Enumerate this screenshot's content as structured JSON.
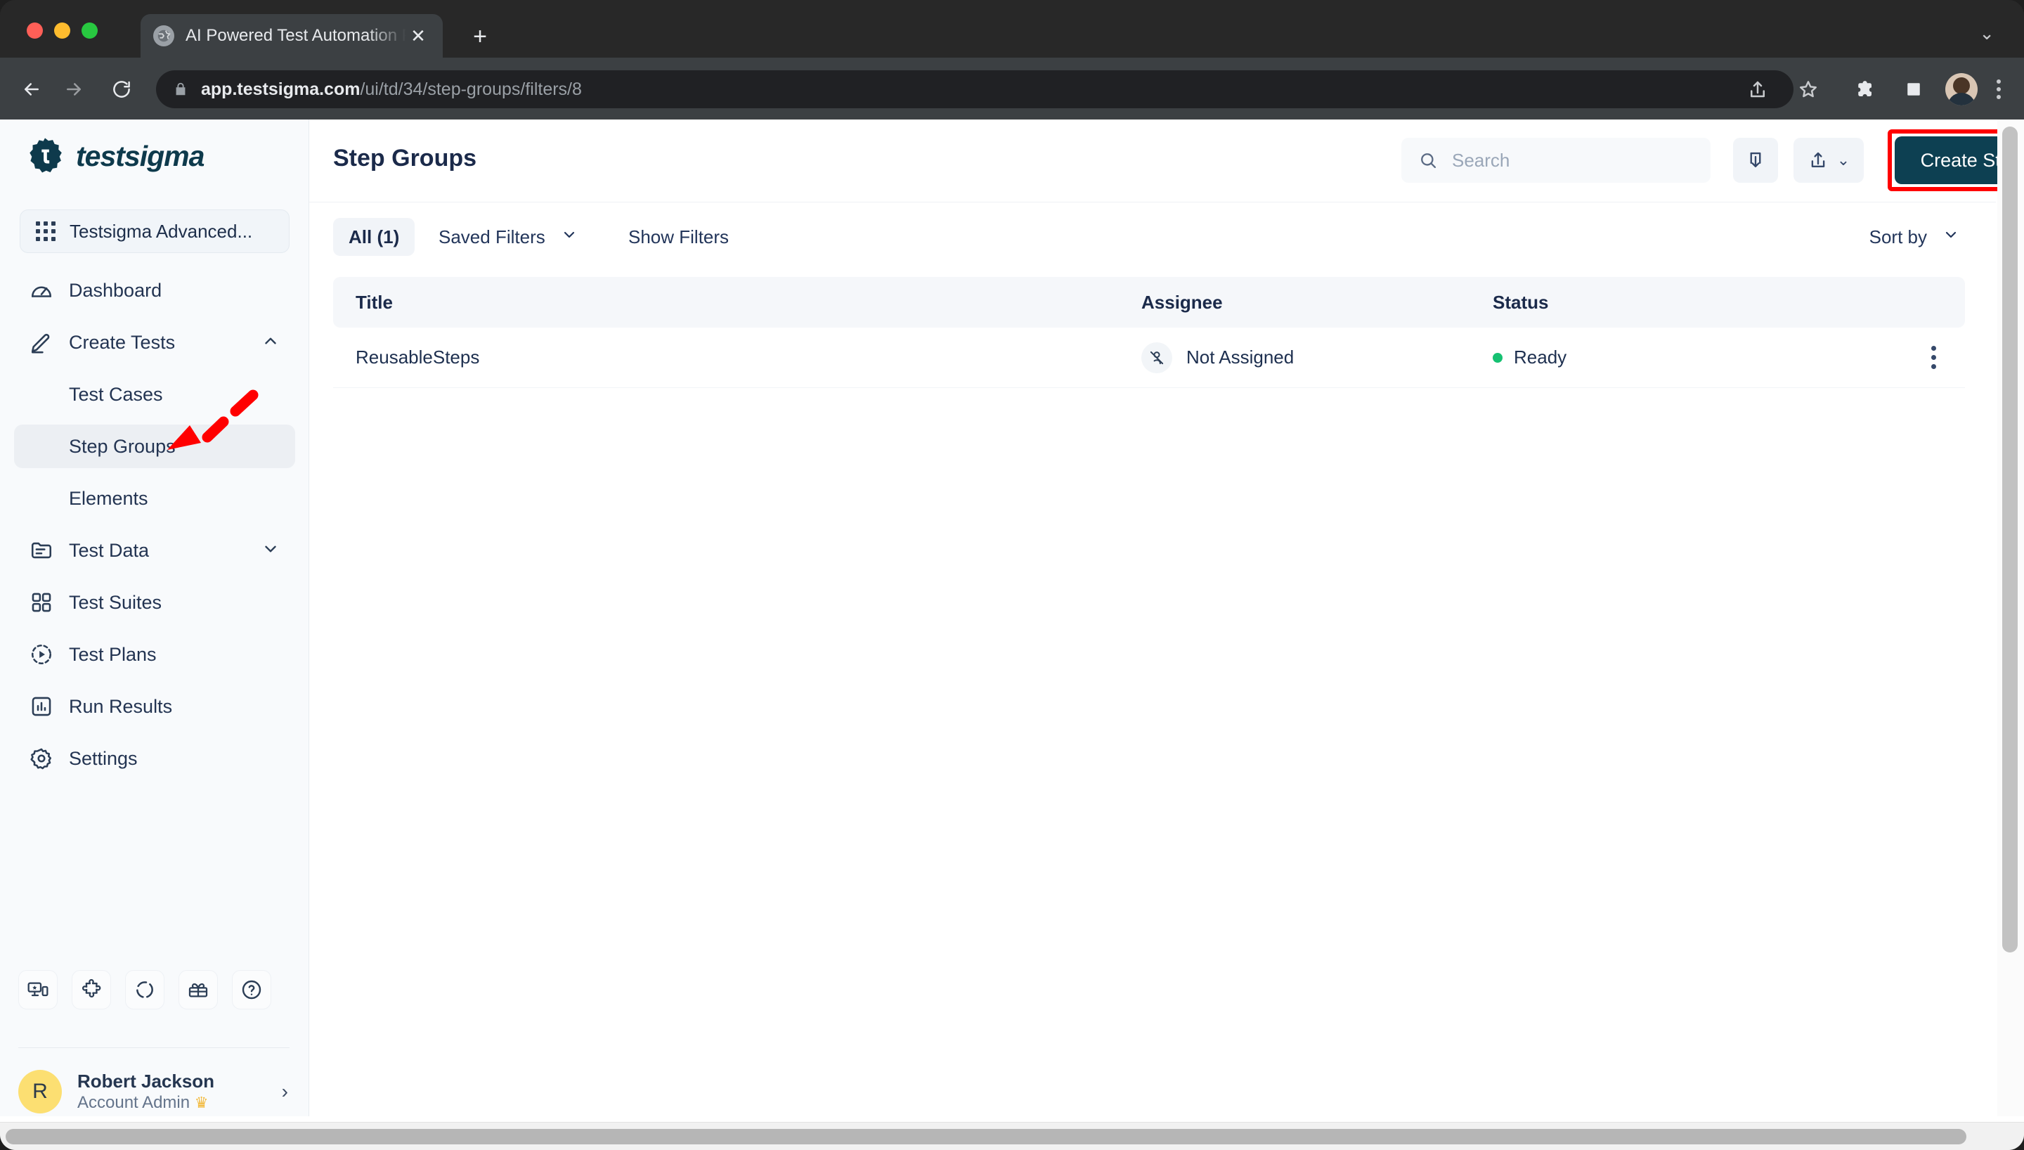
{
  "browser": {
    "tab": {
      "title": "AI Powered Test Automation Pl",
      "favicon_icon": "globe-icon",
      "close_icon": "close-icon"
    },
    "new_tab_label": "+",
    "tabstrip_chevron": "⌄",
    "back_icon": "arrow-left-icon",
    "forward_icon": "arrow-right-icon",
    "reload_icon": "reload-icon",
    "omnibox": {
      "lock_icon": "lock-icon",
      "url_domain": "app.testsigma.com",
      "url_path": "/ui/td/34/step-groups/filters/8"
    },
    "toolbar_icons": [
      "share-icon",
      "star-icon",
      "extensions-icon",
      "side-panel-icon",
      "profile-avatar",
      "chrome-menu-icon"
    ]
  },
  "sidebar": {
    "logo_text": "testsigma",
    "project": {
      "label": "Testsigma Advanced...",
      "icon": "grid-apps-icon"
    },
    "items": [
      {
        "label": "Dashboard",
        "icon": "gauge-icon",
        "level": "top",
        "active": false,
        "chevron": ""
      },
      {
        "label": "Create Tests",
        "icon": "pencil-icon",
        "level": "top",
        "active": false,
        "chevron": "up"
      },
      {
        "label": "Test Cases",
        "icon": "",
        "level": "sub",
        "active": false,
        "chevron": ""
      },
      {
        "label": "Step Groups",
        "icon": "",
        "level": "sub",
        "active": true,
        "chevron": ""
      },
      {
        "label": "Elements",
        "icon": "",
        "level": "sub",
        "active": false,
        "chevron": ""
      },
      {
        "label": "Test Data",
        "icon": "folder-list-icon",
        "level": "top",
        "active": false,
        "chevron": "down"
      },
      {
        "label": "Test Suites",
        "icon": "grid-squares-icon",
        "level": "top",
        "active": false,
        "chevron": ""
      },
      {
        "label": "Test Plans",
        "icon": "play-circle-icon",
        "level": "top",
        "active": false,
        "chevron": ""
      },
      {
        "label": "Run Results",
        "icon": "bar-chart-icon",
        "level": "top",
        "active": false,
        "chevron": ""
      },
      {
        "label": "Settings",
        "icon": "gear-icon",
        "level": "top",
        "active": false,
        "chevron": ""
      }
    ],
    "tools": [
      "devices-icon",
      "puzzle-icon",
      "circle-dashed-icon",
      "gift-icon",
      "help-circle-icon"
    ],
    "user": {
      "initial": "R",
      "name": "Robert Jackson",
      "role": "Account Admin",
      "crown_icon": "crown-icon",
      "chevron": "›"
    }
  },
  "header": {
    "title": "Step Groups",
    "search": {
      "placeholder": "Search",
      "value": "",
      "icon": "search-icon"
    },
    "import_button": {
      "label": "",
      "icon": "import-icon"
    },
    "export_button": {
      "label": "",
      "icon": "export-icon",
      "chevron": "⌄"
    },
    "create_button": {
      "label": "Create Step Group",
      "color": "#0d4052",
      "highlight_color": "#ff0000"
    }
  },
  "filters": {
    "all_chip": "All (1)",
    "saved_filters": {
      "label": "Saved Filters",
      "chevron": "⌄"
    },
    "show_filters": "Show Filters",
    "sort_by": {
      "label": "Sort by",
      "chevron": "⌄"
    }
  },
  "table": {
    "columns": [
      "Title",
      "Assignee",
      "Status",
      ""
    ],
    "rows": [
      {
        "title": "ReusableSteps",
        "assignee": "Not Assigned",
        "assignee_icon": "user-slash-icon",
        "status": "Ready",
        "status_color": "#16c172",
        "actions_icon": "kebab-menu-icon"
      }
    ]
  },
  "annotation": {
    "arrow_color": "#ff0000",
    "target": "Step Groups"
  }
}
